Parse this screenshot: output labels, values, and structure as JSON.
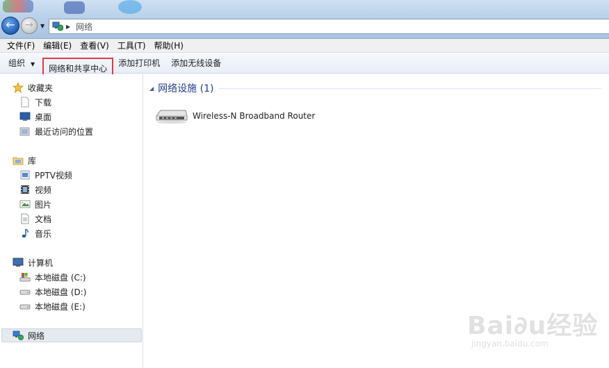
{
  "window": {
    "address_crumb": "网络"
  },
  "menu": {
    "items": [
      "文件(F)",
      "编辑(E)",
      "查看(V)",
      "工具(T)",
      "帮助(H)"
    ]
  },
  "toolbar": {
    "organize": "组织",
    "network_center": "网络和共享中心",
    "add_printer": "添加打印机",
    "add_wireless": "添加无线设备"
  },
  "sidebar": {
    "favorites": "收藏夹",
    "downloads": "下载",
    "desktop": "桌面",
    "recent": "最近访问的位置",
    "libraries": "库",
    "pptv": "PPTV视频",
    "videos": "视频",
    "pictures": "图片",
    "documents": "文档",
    "music": "音乐",
    "computer": "计算机",
    "drive_c": "本地磁盘 (C:)",
    "drive_d": "本地磁盘 (D:)",
    "drive_e": "本地磁盘 (E:)",
    "network": "网络"
  },
  "content": {
    "group_title": "网络设施 (1)",
    "device_name": "Wireless-N Broadband Router"
  },
  "watermark": {
    "main": "Bai∂u经验",
    "sub": "jingyan.baidu.com"
  },
  "colors": {
    "accent_blue": "#1e3e8e",
    "highlight_red": "#e23b3b"
  }
}
